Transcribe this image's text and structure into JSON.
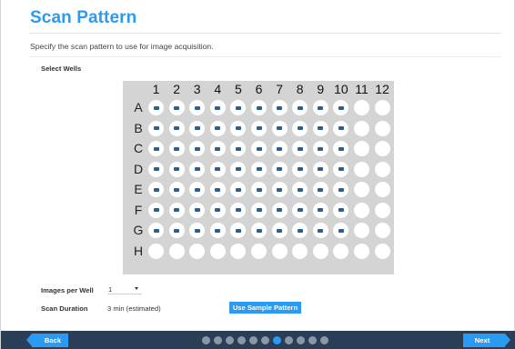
{
  "page": {
    "title": "Scan Pattern",
    "subtitle": "Specify the scan pattern to use for image acquisition.",
    "select_wells_label": "Select Wells"
  },
  "plate": {
    "columns": [
      "1",
      "2",
      "3",
      "4",
      "5",
      "6",
      "7",
      "8",
      "9",
      "10",
      "11",
      "12"
    ],
    "rows": [
      "A",
      "B",
      "C",
      "D",
      "E",
      "F",
      "G",
      "H"
    ],
    "selected": [
      [
        1,
        1,
        1,
        1,
        1,
        1,
        1,
        1,
        1,
        1,
        0,
        0
      ],
      [
        1,
        1,
        1,
        1,
        1,
        1,
        1,
        1,
        1,
        1,
        0,
        0
      ],
      [
        1,
        1,
        1,
        1,
        1,
        1,
        1,
        1,
        1,
        1,
        0,
        0
      ],
      [
        1,
        1,
        1,
        1,
        1,
        1,
        1,
        1,
        1,
        1,
        0,
        0
      ],
      [
        1,
        1,
        1,
        1,
        1,
        1,
        1,
        1,
        1,
        1,
        0,
        0
      ],
      [
        1,
        1,
        1,
        1,
        1,
        1,
        1,
        1,
        1,
        1,
        0,
        0
      ],
      [
        1,
        1,
        1,
        1,
        1,
        1,
        1,
        1,
        1,
        1,
        0,
        0
      ],
      [
        0,
        0,
        0,
        0,
        0,
        0,
        0,
        0,
        0,
        0,
        0,
        0
      ]
    ]
  },
  "form": {
    "images_per_well_label": "Images per Well",
    "images_per_well_value": "1",
    "scan_duration_label": "Scan Duration",
    "scan_duration_value": "3 min (estimated)",
    "use_sample_pattern_label": "Use Sample Pattern"
  },
  "footer": {
    "back_label": "Back",
    "next_label": "Next",
    "step_count": 11,
    "active_step": 7
  },
  "colors": {
    "accent": "#2b9af3",
    "footer": "#2a3f57",
    "plate": "#d4d4d4",
    "well_marker": "#2f5e8e"
  }
}
